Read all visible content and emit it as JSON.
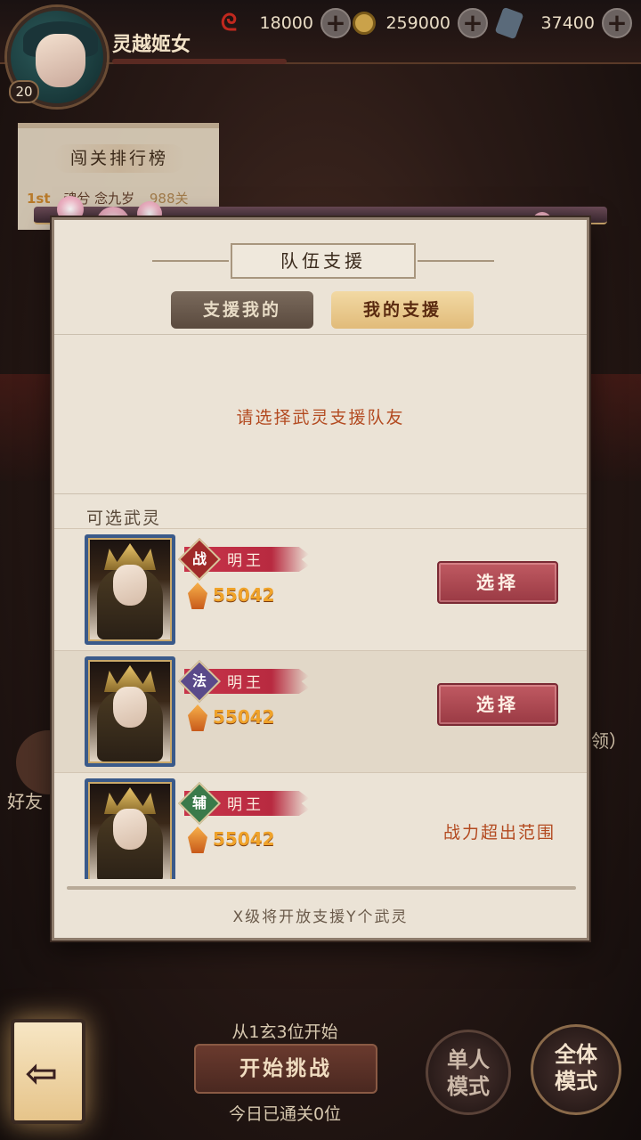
{
  "player": {
    "name": "灵越姬女",
    "level": "20"
  },
  "currencies": [
    {
      "icon": "spiral-token-icon",
      "value": "18000",
      "color": "#c0281e"
    },
    {
      "icon": "coin-icon",
      "value": "259000",
      "color": "#caa24a"
    },
    {
      "icon": "crystal-icon",
      "value": "37400",
      "color": "#6a7a8a"
    }
  ],
  "leaderboard": {
    "title": "闯关排行榜",
    "row": {
      "rank": "1st",
      "name": "魂兮 念九岁",
      "score": "988关"
    }
  },
  "background": {
    "friends_label": "好友",
    "claim_fragment": "领）"
  },
  "modal": {
    "title": "队伍支援",
    "tabs": [
      {
        "label": "支援我的",
        "active": false
      },
      {
        "label": "我的支援",
        "active": true
      }
    ],
    "empty_message": "请选择武灵支援队友",
    "available_label": "可选武灵",
    "items": [
      {
        "class": "战",
        "class_color": "#a02a2a",
        "name": "明王",
        "power": "55042",
        "action": "选择"
      },
      {
        "class": "法",
        "class_color": "#5a4a8a",
        "name": "明王",
        "power": "55042",
        "action": "选择"
      },
      {
        "class": "辅",
        "class_color": "#3a7a4a",
        "name": "明王",
        "power": "55042",
        "status": "战力超出范围"
      }
    ],
    "unlock_note": "X级将开放支援Y个武灵"
  },
  "bottom": {
    "start_hint": "从1玄3位开始",
    "start_button": "开始挑战",
    "cleared_today": "今日已通关0位",
    "mode_single_line1": "单人",
    "mode_single_line2": "模式",
    "mode_all_line1": "全体",
    "mode_all_line2": "模式"
  }
}
